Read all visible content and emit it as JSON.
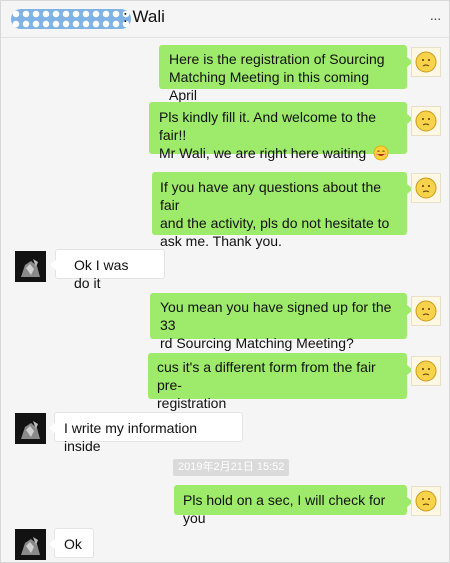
{
  "header": {
    "title": ": Wali",
    "more_icon": "more-icon"
  },
  "colors": {
    "sent_bubble": "#9eea6a",
    "received_bubble": "#ffffff",
    "background": "#f5f5f5",
    "timestamp_bg": "#dadada"
  },
  "messages": [
    {
      "side": "sent",
      "lines": [
        "Here is the registration of Sourcing",
        "Matching Meeting in this coming April"
      ]
    },
    {
      "side": "sent",
      "lines": [
        "Pls kindly fill it. And welcome to the fair!!",
        "Mr Wali, we are right here waiting"
      ],
      "emoji": "smile-emoji"
    },
    {
      "side": "sent",
      "lines": [
        "If you have any questions about the fair",
        "and the activity, pls do not hesitate to",
        "ask me. Thank you."
      ]
    },
    {
      "side": "received",
      "lines": [
        "Ok I was do it"
      ]
    },
    {
      "side": "sent",
      "lines": [
        "You mean you have signed up for the 33",
        "rd Sourcing Matching Meeting?"
      ]
    },
    {
      "side": "sent",
      "lines": [
        "cus it's a different form from the fair pre-",
        "registration"
      ]
    },
    {
      "side": "received",
      "lines": [
        "I write my information inside"
      ]
    },
    {
      "side": "sent",
      "lines": [
        "Pls hold on a sec, I will check for you"
      ]
    },
    {
      "side": "received",
      "lines": [
        "Ok"
      ]
    }
  ],
  "timestamp": "2019年2月21日 15:52"
}
